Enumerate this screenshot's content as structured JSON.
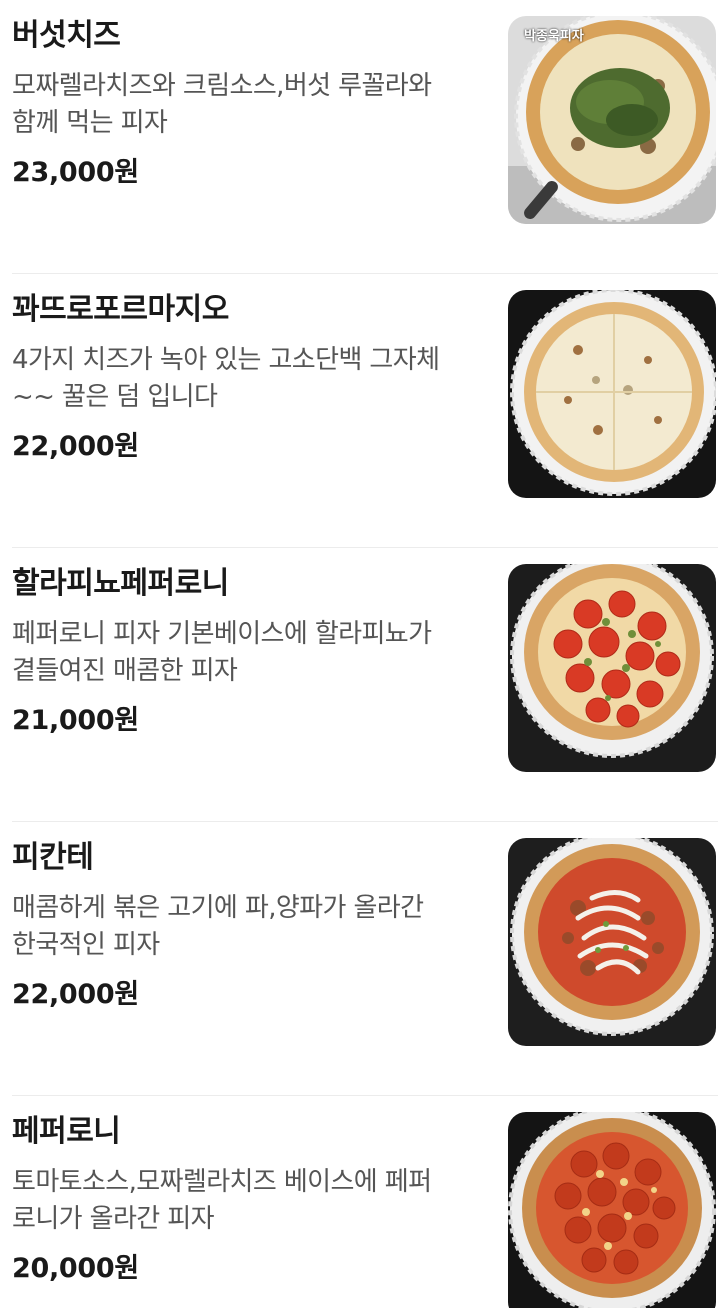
{
  "menu": {
    "items": [
      {
        "name": "버섯치즈",
        "desc_line1": "모짜렐라치즈와 크림소스,버섯 루꼴라와",
        "desc_line2": "함께 먹는 피자",
        "price": "23,000원",
        "watermark": "박종욱피자",
        "image_icon": "mushroom-cheese-pizza-photo"
      },
      {
        "name": "꽈뜨로포르마지오",
        "desc_line1": "4가지 치즈가 녹아 있는 고소단백 그자체",
        "desc_line2": "~~ 꿀은 덤 입니다",
        "price": "22,000원",
        "image_icon": "four-cheese-pizza-photo"
      },
      {
        "name": "할라피뇨페퍼로니",
        "desc_line1": "페퍼로니 피자 기본베이스에 할라피뇨가",
        "desc_line2": "곁들여진 매콤한 피자",
        "price": "21,000원",
        "image_icon": "jalapeno-pepperoni-pizza-photo"
      },
      {
        "name": "피칸테",
        "desc_line1": "매콤하게 볶은 고기에 파,양파가 올라간",
        "desc_line2": "한국적인 피자",
        "price": "22,000원",
        "image_icon": "piccante-pizza-photo"
      },
      {
        "name": "페퍼로니",
        "desc_line1": "토마토소스,모짜렐라치즈 베이스에 페퍼",
        "desc_line2": "로니가 올라간 피자",
        "price": "20,000원",
        "image_icon": "pepperoni-pizza-photo"
      }
    ]
  }
}
